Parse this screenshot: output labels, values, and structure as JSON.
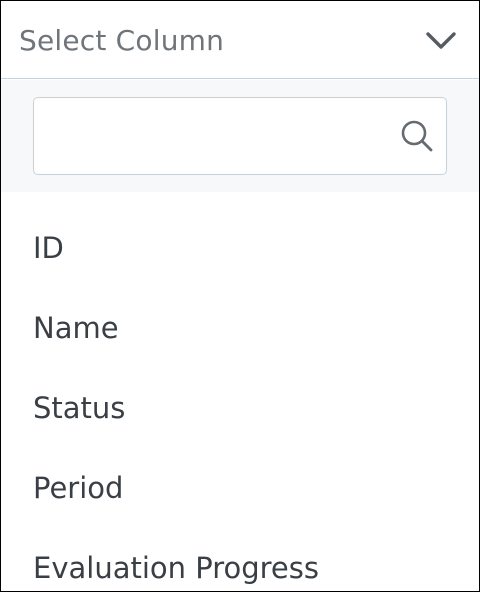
{
  "select": {
    "placeholder": "Select Column",
    "toggle_icon": "chevron-down-icon"
  },
  "search": {
    "value": "",
    "placeholder": "",
    "icon": "search-icon"
  },
  "options": [
    {
      "label": "ID"
    },
    {
      "label": "Name"
    },
    {
      "label": "Status"
    },
    {
      "label": "Period"
    },
    {
      "label": "Evaluation Progress"
    }
  ],
  "colors": {
    "text": "#3a3f45",
    "placeholder": "#6f757a",
    "border": "#c9d0d6",
    "search_band": "#f6f8fa"
  }
}
